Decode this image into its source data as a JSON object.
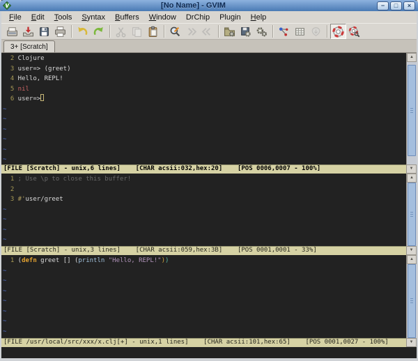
{
  "window": {
    "title": "[No Name] - GVIM",
    "controls": [
      {
        "name": "minimize",
        "glyph": "−"
      },
      {
        "name": "maximize",
        "glyph": "□"
      },
      {
        "name": "close",
        "glyph": "×"
      }
    ]
  },
  "menu": {
    "items": [
      {
        "label": "File",
        "mnemonic": 0
      },
      {
        "label": "Edit",
        "mnemonic": 0
      },
      {
        "label": "Tools",
        "mnemonic": 0
      },
      {
        "label": "Syntax",
        "mnemonic": 0
      },
      {
        "label": "Buffers",
        "mnemonic": 0
      },
      {
        "label": "Window",
        "mnemonic": 0
      },
      {
        "label": "DrChip",
        "mnemonic": null
      },
      {
        "label": "Plugin",
        "mnemonic": null
      },
      {
        "label": "Help",
        "mnemonic": 0
      }
    ]
  },
  "toolbar": {
    "buttons": [
      {
        "name": "open"
      },
      {
        "name": "save"
      },
      {
        "name": "save-all"
      },
      {
        "name": "print"
      },
      {
        "sep": true
      },
      {
        "name": "undo"
      },
      {
        "name": "redo"
      },
      {
        "sep": true
      },
      {
        "name": "cut",
        "disabled": true
      },
      {
        "name": "copy",
        "disabled": true
      },
      {
        "name": "paste"
      },
      {
        "sep": true
      },
      {
        "name": "find"
      },
      {
        "name": "find-next",
        "disabled": true
      },
      {
        "name": "find-prev",
        "disabled": true
      },
      {
        "sep": true
      },
      {
        "name": "load-session"
      },
      {
        "name": "save-session"
      },
      {
        "name": "run-script"
      },
      {
        "sep": true
      },
      {
        "name": "make"
      },
      {
        "name": "build-tags"
      },
      {
        "name": "jump-tag",
        "disabled": true
      },
      {
        "sep": true
      },
      {
        "name": "vim-help",
        "pressed": true
      },
      {
        "name": "find-help"
      }
    ]
  },
  "tabbar": {
    "tabs": [
      {
        "label": "3+ [Scratch]",
        "active": true
      }
    ]
  },
  "panes": [
    {
      "lines": [
        {
          "num": "2",
          "segments": [
            {
              "t": "Clojure",
              "c": "fg"
            }
          ]
        },
        {
          "num": "3",
          "segments": [
            {
              "t": "user=> (greet)",
              "c": "fg"
            }
          ]
        },
        {
          "num": "4",
          "segments": [
            {
              "t": "Hello, REPL!",
              "c": "fg"
            }
          ]
        },
        {
          "num": "5",
          "segments": [
            {
              "t": "nil",
              "c": "red"
            }
          ]
        },
        {
          "num": "6",
          "segments": [
            {
              "t": "user=>",
              "c": "fg"
            }
          ],
          "cursor": true
        }
      ],
      "tildes": 6,
      "statusline": "[FILE [Scratch] - unix,6 lines]    [CHAR acsii:032,hex:20]    [POS 0006,0007 - 100%]",
      "statusline_active": true
    },
    {
      "lines": [
        {
          "num": "1",
          "segments": [
            {
              "t": "; Use \\p to close this buffer!",
              "c": "comment"
            }
          ]
        },
        {
          "num": "2",
          "segments": []
        },
        {
          "num": "3",
          "segments": [
            {
              "t": "#'",
              "c": "olive"
            },
            {
              "t": "user/greet",
              "c": "fg"
            }
          ]
        }
      ],
      "tildes": 4,
      "statusline": "[FILE [Scratch] - unix,3 lines]    [CHAR acsii:059,hex:3B]    [POS 0001,0001 - 33%]",
      "statusline_active": false
    },
    {
      "lines": [
        {
          "num": "1",
          "segments": [
            {
              "t": "(",
              "c": "fg"
            },
            {
              "t": "defn",
              "c": "orange"
            },
            {
              "t": " greet [] ",
              "c": "fg"
            },
            {
              "t": "(",
              "c": "fg"
            },
            {
              "t": "println",
              "c": "blue"
            },
            {
              "t": " ",
              "c": "fg"
            },
            {
              "t": "\"Hello, REPL!\"",
              "c": "purple"
            },
            {
              "t": ")",
              "c": "porange"
            },
            {
              "t": ")",
              "c": "pteal"
            }
          ]
        }
      ],
      "tildes": 7,
      "statusline": "[FILE /usr/local/src/xxx/x.clj[+] - unix,1 lines]    [CHAR acsii:101,hex:65]    [POS 0001,0027 - 100%]",
      "statusline_active": false
    }
  ],
  "cmdline": {
    "text": ""
  },
  "colors": {
    "titlebar_top": "#8db2de",
    "titlebar_bottom": "#4a7ab4",
    "chrome_bg": "#d9d6d0",
    "editor_bg": "#222222",
    "editor_fg": "#dadada",
    "line_number": "#a89a55",
    "tilde": "#4f6fd0",
    "comment": "#6a6a6a",
    "keyword_orange": "#e0a030",
    "builtin_blue": "#a0c0dc",
    "string_purple": "#b294bb",
    "paren_orange": "#d0a040",
    "paren_teal": "#56b6a2",
    "reader_macro_olive": "#b3a05f",
    "nil_red": "#cc6666",
    "statusline_bg": "#d6d2a4",
    "scrollbar_thumb": "#a4bede"
  }
}
